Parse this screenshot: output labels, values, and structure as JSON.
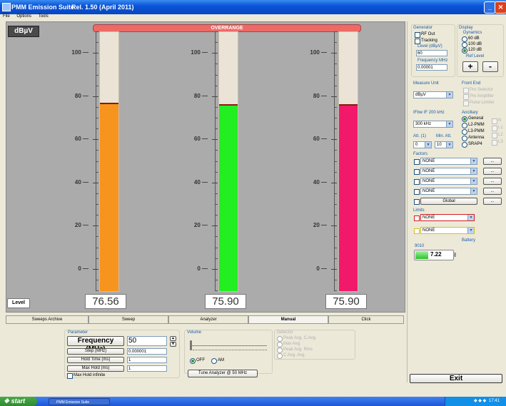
{
  "window": {
    "title": "PMM Emission Suite",
    "version": "Rel. 1.50 (April 2011)"
  },
  "menu": [
    "File",
    "Options",
    "Tools"
  ],
  "meter": {
    "unit": "dBµV",
    "overrange_label": "OVERRANGE",
    "scale_labels": [
      "100",
      "80",
      "60",
      "40",
      "20",
      "0"
    ],
    "level_button": "Level",
    "bars": [
      {
        "name": "bar-1",
        "value": "76.56",
        "level": 76.56,
        "color": "#f7941d"
      },
      {
        "name": "bar-2",
        "value": "75.90",
        "level": 75.9,
        "color": "#22ee22"
      },
      {
        "name": "bar-3",
        "value": "75.90",
        "level": 75.9,
        "color": "#f2186a"
      }
    ]
  },
  "right_panel": {
    "generator": {
      "title": "Generator",
      "rf_out": "RF Out",
      "tracking": "Tracking",
      "level_label": "Level (dBµV)",
      "level_value": "60",
      "freq_label": "Frequency MHz",
      "freq_value": "0.00001"
    },
    "display": {
      "title": "Display",
      "dynamics_label": "Dynamics",
      "options": [
        "60 dB",
        "100 dB",
        "120 dB"
      ],
      "ref_level_label": "Ref Level",
      "plus": "+",
      "minus": "-"
    },
    "measure_unit": {
      "label": "Measure Unit",
      "value": "dBµV"
    },
    "front_end": {
      "label": "Front End",
      "options": [
        "Pre Selector",
        "Pre Amplifier",
        "Pulse Limiter"
      ]
    },
    "ifbw": {
      "label": "IFbw IF 200 kHz",
      "value": "300 kHz"
    },
    "att": {
      "label": "Att. (1)",
      "value": "0"
    },
    "min_att": {
      "label": "Min. Att.",
      "value": "10"
    },
    "ancillary": {
      "label": "Ancillary",
      "options": [
        "General",
        "L2-PMM",
        "L3-PMM",
        "Antenna",
        "SRAP4"
      ],
      "right_labels": [
        "N",
        "L1",
        "L2",
        "L3"
      ]
    },
    "factors": {
      "label": "Factors",
      "rows": [
        "NONE",
        "NONE",
        "NONE",
        "NONE"
      ],
      "global_label": "Global",
      "btn": "..."
    },
    "limits": {
      "label": "Limits",
      "rows": [
        "NONE",
        "NONE"
      ]
    },
    "battery": {
      "label": "Battery",
      "device": "9010",
      "value": "7.22"
    },
    "exit_label": "Exit"
  },
  "tabs": [
    "Sweeps Archive",
    "Sweep",
    "Analyzer",
    "Manual",
    "Click"
  ],
  "manual": {
    "parameter_label": "Parameter",
    "frequency_label": "Frequency (MHz)",
    "frequency_value": "50",
    "step_label": "Step (MHz)",
    "step_value": "0.000001",
    "hold_label": "Hold Time (ms)",
    "hold_value": "1",
    "maxhold_label": "Max Hold (ms)",
    "maxhold_value": "1",
    "maxhold_inf_label": "Max Hold infinite",
    "volume_label": "Volume",
    "off_label": "OFF",
    "am_label": "AM",
    "tune_label": "Tune Analyzer @ 50 MHz",
    "demod_label": "Detector",
    "demod_options": [
      "Peak Avg. C.Avg.",
      "Max Avg.",
      "Peak Avg. Rms",
      "C.Avg. Avg."
    ]
  },
  "taskbar": {
    "start": "start",
    "task": "PMM Emission Suite",
    "clock": "17:41"
  }
}
